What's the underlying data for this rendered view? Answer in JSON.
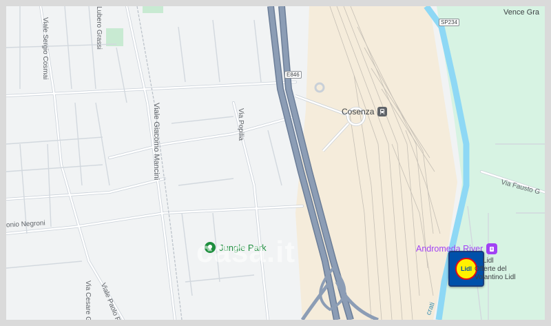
{
  "map": {
    "colors": {
      "urban": "#f1f3f4",
      "road": "#ffffff",
      "road_casing": "#c9d0d8",
      "highway": "#8c9db5",
      "highway_casing": "#6b7d97",
      "rail_area": "#f5ecdb",
      "river": "#8ed8f5",
      "park": "#d7f3e3",
      "poi_green": "#1e8e3e",
      "poi_purple": "#a142f4"
    },
    "street_labels": {
      "viale_sergio_cosmai": "Viale Sergio Cosmai",
      "lubero_grassi": "Lubero Grassi",
      "viale_giacomo_mancini": "Viale Giacomo Mancini",
      "via_popilia": "Via Popilia",
      "onio_negroni": "onio Negroni",
      "via_cesare": "Via Cesare G",
      "viale_paolo": "Viale Paolo R",
      "via_fausto": "Via Fausto G",
      "vence_gra": "Vence Gra",
      "crati": "crati"
    },
    "road_shields": {
      "e846": "E846",
      "sp234": "SP234"
    },
    "pois": {
      "cosenza": {
        "label": "Cosenza",
        "icon": "train-station-icon"
      },
      "jungle_park": {
        "label": "Jungle Park",
        "icon": "park-icon"
      },
      "andromeda_river": {
        "label": "Andromeda River",
        "icon": "shopping-icon"
      },
      "lidl": {
        "label_line1": "Offerte del",
        "label_line2": "Volantino Lidl",
        "brand_text": "Lidl",
        "logo_text": "Lidl",
        "icon": "lidl-logo-icon"
      }
    },
    "watermark": "casa.it"
  }
}
